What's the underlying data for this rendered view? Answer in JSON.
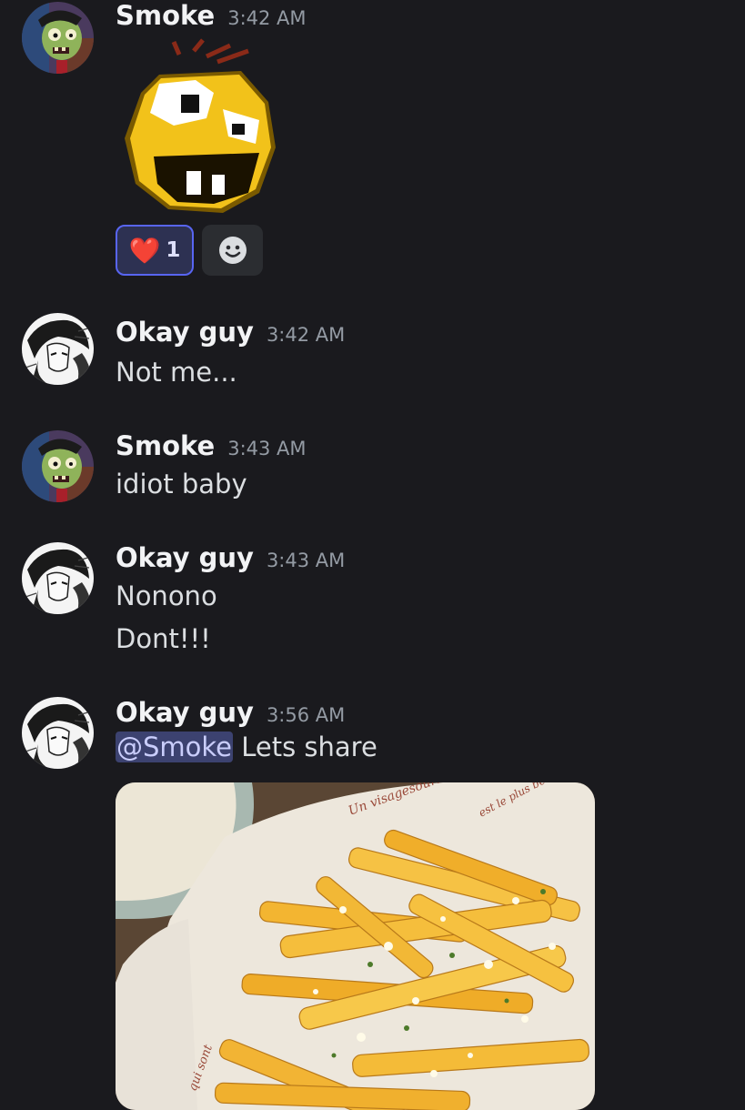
{
  "messages": [
    {
      "author": "Smoke",
      "time": "3:42 AM",
      "sticker": "angry-face-sticker",
      "reactions": [
        {
          "emoji": "❤️",
          "count": "1"
        }
      ]
    },
    {
      "author": "Okay guy",
      "time": "3:42 AM",
      "lines": [
        "Not me..."
      ]
    },
    {
      "author": "Smoke",
      "time": "3:43 AM",
      "lines": [
        "idiot baby"
      ]
    },
    {
      "author": "Okay guy",
      "time": "3:43 AM",
      "lines": [
        "Nonono",
        "Dont!!!"
      ]
    },
    {
      "author": "Okay guy",
      "time": "3:56 AM",
      "mention": "@Smoke",
      "text": " Lets share",
      "attachment": "french-fries-photo"
    }
  ],
  "photo_text": {
    "line1": "Un visagesouriant",
    "line2": "est le plus beau",
    "line3": "qui sont"
  },
  "colors": {
    "background": "#1a1a1e",
    "mention_bg": "#3c4270",
    "reaction_border": "#5865f2"
  }
}
